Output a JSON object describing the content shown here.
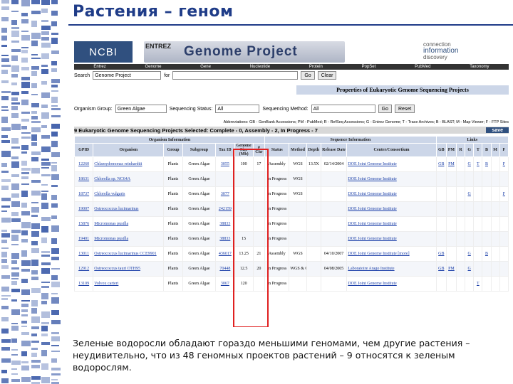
{
  "slide": {
    "title": "Растения – геном",
    "caption": "Зеленые водоросли обладают гораздо меньшими геномами, чем другие растения – неудивительно, что из 48 геномных проектов растений – 9 относятся к зеленым водорослям."
  },
  "header": {
    "logo": "NCBI",
    "entrez": "ENTREZ",
    "banner": "Genome Project",
    "tagline": [
      "connection",
      "information",
      "discovery"
    ]
  },
  "nav": [
    "Entrez",
    "Genome",
    "Gene",
    "Nucleotide",
    "Protein",
    "PopSet",
    "PubMed",
    "Taxonomy"
  ],
  "search": {
    "label": "Search",
    "value": "Genome Project",
    "for_label": "for",
    "go": "Go",
    "clear": "Clear"
  },
  "properties_title": "Properties of Eukaryotic Genome Sequencing Projects",
  "filters": {
    "group_label": "Organism Group:",
    "group_value": "Green Algae",
    "status_label": "Sequencing Status:",
    "status_value": "All",
    "method_label": "Sequencing Method:",
    "method_value": "All",
    "go": "Go",
    "reset": "Reset"
  },
  "abbreviations": "Abbreviations: GB - GenBank Accessions; PM - PubMed; R - RefSeq Accessions; G - Entrez Genome; T - Trace Archives; B - BLAST; M - Map Viewer; F - FTP Sites",
  "selection": {
    "text": "9 Eukaryotic Genome Sequencing Projects Selected: Complete - 0, Assembly - 2, In Progress - 7",
    "save": "save"
  },
  "table": {
    "group_headers": [
      "Organism Information",
      "Sequence Information",
      "Links"
    ],
    "columns": [
      "GPID",
      "Organism",
      "Group",
      "Subgroup",
      "Tax ID",
      "Genome Size (Mb)",
      "# Chr",
      "Status",
      "Method",
      "Depth",
      "Release Date",
      "Center/Consortium",
      "GB",
      "PM",
      "R",
      "G",
      "T",
      "B",
      "M",
      "F"
    ],
    "rows": [
      [
        "12260",
        "Chlamydomonas reinhardtii",
        "Plants",
        "Green Algae",
        "3055",
        "100",
        "17",
        "Assembly",
        "WGS",
        "13.5X",
        "02/14/2004",
        "DOE Joint Genome Institute",
        "GB",
        "PM",
        "",
        "G",
        "T",
        "B",
        "",
        "F"
      ],
      [
        "18631",
        "Chlorella sp. NC64A",
        "Plants",
        "Green Algae",
        "",
        "",
        "",
        "In Progress",
        "WGS",
        "",
        "",
        "DOE Joint Genome Institute",
        "",
        "",
        "",
        "",
        "",
        "",
        "",
        ""
      ],
      [
        "18737",
        "Chlorella vulgaris",
        "Plants",
        "Green Algae",
        "3077",
        "",
        "",
        "In Progress",
        "WGS",
        "",
        "",
        "DOE Joint Genome Institute",
        "",
        "",
        "",
        "G",
        "",
        "",
        "",
        "F"
      ],
      [
        "19007",
        "Ostreococcus lucimarinus",
        "Plants",
        "Green Algae",
        "242159",
        "",
        "",
        "In Progress",
        "",
        "",
        "",
        "DOE Joint Genome Institute",
        "",
        "",
        "",
        "",
        "",
        "",
        "",
        ""
      ],
      [
        "15876",
        "Micromonas pusilla",
        "Plants",
        "Green Algae",
        "38833",
        "",
        "",
        "In Progress",
        "",
        "",
        "",
        "DOE Joint Genome Institute",
        "",
        "",
        "",
        "",
        "",
        "",
        "",
        ""
      ],
      [
        "19401",
        "Micromonas pusilla",
        "Plants",
        "Green Algae",
        "38833",
        "15",
        "",
        "In Progress",
        "",
        "",
        "",
        "DOE Joint Genome Institute",
        "",
        "",
        "",
        "",
        "",
        "",
        "",
        ""
      ],
      [
        "13011",
        "Ostreococcus lucimarinus CCE9901",
        "Plants",
        "Green Algae",
        "436017",
        "13.25",
        "21",
        "Assembly",
        "WGS",
        "",
        "04/10/2007",
        "DOE Joint Genome Institute [more]",
        "GB",
        "",
        "",
        "G",
        "",
        "B",
        "",
        ""
      ],
      [
        "12912",
        "Ostreococcus tauri OTH95",
        "Plants",
        "Green Algae",
        "70448",
        "12.5",
        "20",
        "In Progress",
        "WGS & Clone-based",
        "",
        "04/08/2005",
        "Laboratoire Arago Institute",
        "GB",
        "PM",
        "",
        "G",
        "",
        "",
        "",
        ""
      ],
      [
        "13109",
        "Volvox carteri",
        "Plants",
        "Green Algae",
        "3067",
        "120",
        "",
        "In Progress",
        "",
        "",
        "",
        "DOE Joint Genome Institute",
        "",
        "",
        "",
        "",
        "T",
        "",
        "",
        ""
      ]
    ]
  },
  "colors": {
    "title": "#1f3c88",
    "highlight": "#e02020",
    "header_bg": "#ccd6e8",
    "link": "#1a3ea8"
  }
}
